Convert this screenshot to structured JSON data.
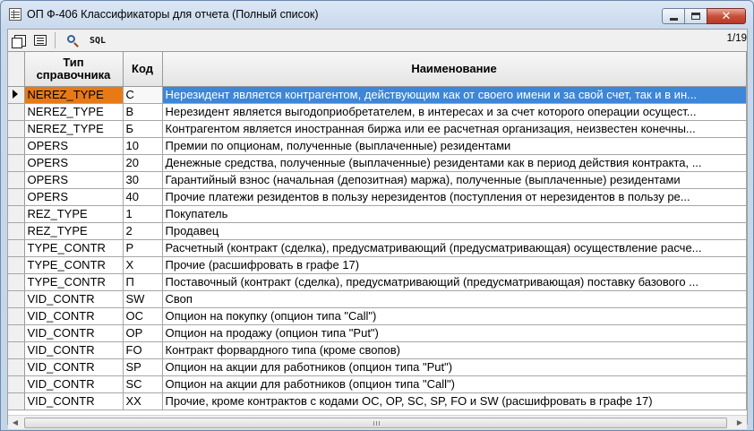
{
  "window": {
    "title": "ОП Ф-406 Классификаторы для отчета (Полный список)",
    "minimize_icon": "minimize-icon",
    "maximize_icon": "maximize-icon",
    "close_label": "✕"
  },
  "toolbar": {
    "copy_icon": "copy-icon",
    "form_icon": "form-view-icon",
    "search_icon": "search-icon",
    "sql_label": "SQL",
    "page_count": "1/19"
  },
  "grid": {
    "columns": [
      {
        "line1": "Тип",
        "line2": "справочника"
      },
      {
        "line1": "Код",
        "line2": ""
      },
      {
        "line1": "Наименование",
        "line2": ""
      }
    ],
    "selected_row_index": 0,
    "colors": {
      "selected_type_bg": "#e87a16",
      "selected_name_bg": "#3d86d8"
    },
    "rows": [
      {
        "type": "NEREZ_TYPE",
        "code": "С",
        "name": "Нерезидент является контрагентом, действующим как от своего имени и за свой счет, так и в ин..."
      },
      {
        "type": "NEREZ_TYPE",
        "code": "В",
        "name": "Нерезидент является выгодоприобретателем, в интересах и за счет которого операции осущест..."
      },
      {
        "type": "NEREZ_TYPE",
        "code": "Б",
        "name": "Контрагентом является иностранная биржа или ее расчетная организация, неизвестен конечны..."
      },
      {
        "type": "OPERS",
        "code": "10",
        "name": "Премии по опционам, полученные (выплаченные) резидентами"
      },
      {
        "type": "OPERS",
        "code": "20",
        "name": "Денежные средства, полученные (выплаченные) резидентами как в период действия контракта, ..."
      },
      {
        "type": "OPERS",
        "code": "30",
        "name": "Гарантийный взнос (начальная (депозитная) маржа), полученные (выплаченные) резидентами"
      },
      {
        "type": "OPERS",
        "code": "40",
        "name": "Прочие платежи резидентов в пользу нерезидентов (поступления от нерезидентов в пользу ре..."
      },
      {
        "type": "REZ_TYPE",
        "code": "1",
        "name": "Покупатель"
      },
      {
        "type": "REZ_TYPE",
        "code": "2",
        "name": "Продавец"
      },
      {
        "type": "TYPE_CONTR",
        "code": "Р",
        "name": "Расчетный (контракт (сделка), предусматривающий (предусматривающая) осуществление расче..."
      },
      {
        "type": "TYPE_CONTR",
        "code": "Х",
        "name": "Прочие (расшифровать в графе 17)"
      },
      {
        "type": "TYPE_CONTR",
        "code": "П",
        "name": "Поставочный (контракт (сделка), предусматривающий (предусматривающая) поставку базового ..."
      },
      {
        "type": "VID_CONTR",
        "code": "SW",
        "name": "Своп"
      },
      {
        "type": "VID_CONTR",
        "code": "OC",
        "name": "Опцион на покупку (опцион типа \"Call\")"
      },
      {
        "type": "VID_CONTR",
        "code": "OP",
        "name": "Опцион на продажу (опцион типа \"Put\")"
      },
      {
        "type": "VID_CONTR",
        "code": "FO",
        "name": "Контракт форвардного типа (кроме свопов)"
      },
      {
        "type": "VID_CONTR",
        "code": "SP",
        "name": "Опцион на акции для работников (опцион типа \"Put\")"
      },
      {
        "type": "VID_CONTR",
        "code": "SC",
        "name": "Опцион на акции для работников (опцион типа \"Call\")"
      },
      {
        "type": "VID_CONTR",
        "code": "XX",
        "name": "Прочие, кроме контрактов с кодами OC, OP, SC, SP, FO и SW (расшифровать в графе 17)"
      }
    ]
  },
  "hscroll": {
    "left_arrow": "◀",
    "right_arrow": "▶"
  }
}
